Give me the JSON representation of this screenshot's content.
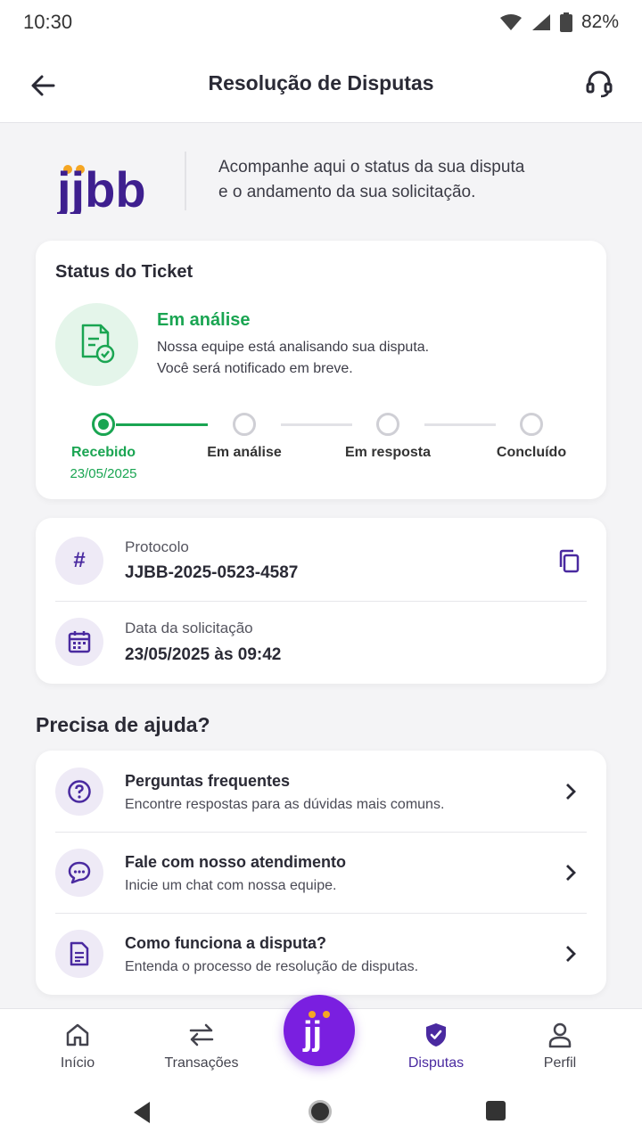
{
  "status_bar": {
    "time": "10:30",
    "battery": "82%"
  },
  "app_bar": {
    "title": "Resolução de Disputas"
  },
  "intro": {
    "logo_text": "jjbb",
    "line1": "Acompanhe aqui o status da sua disputa",
    "line2": "e o andamento da sua solicitação."
  },
  "ticket": {
    "heading": "Status do Ticket",
    "status_title": "Em análise",
    "status_line1": "Nossa equipe está analisando sua disputa.",
    "status_line2": "Você será notificado em breve.",
    "steps": [
      {
        "label": "Recebido",
        "date": "23/05/2025",
        "active": true
      },
      {
        "label": "Em análise",
        "active": false
      },
      {
        "label": "Em resposta",
        "active": false
      },
      {
        "label": "Concluído",
        "active": false
      }
    ]
  },
  "info": {
    "protocol_label": "Protocolo",
    "protocol_value": "JJBB-2025-0523-4587",
    "date_label": "Data da solicitação",
    "date_value": "23/05/2025 às 09:42"
  },
  "help": {
    "title": "Precisa de ajuda?",
    "items": [
      {
        "title": "Perguntas frequentes",
        "subtitle": "Encontre respostas para as dúvidas mais comuns.",
        "icon": "question-icon"
      },
      {
        "title": "Fale com nosso atendimento",
        "subtitle": "Inicie um chat com nossa equipe.",
        "icon": "chat-icon"
      },
      {
        "title": "Como funciona a disputa?",
        "subtitle": "Entenda o processo de resolução de disputas.",
        "icon": "document-icon"
      }
    ]
  },
  "bottom_nav": {
    "items": [
      {
        "label": "Início",
        "icon": "home-icon"
      },
      {
        "label": "Transações",
        "icon": "transfer-icon"
      },
      {
        "label": "Disputas",
        "icon": "shield-check-icon",
        "active": true
      },
      {
        "label": "Perfil",
        "icon": "profile-icon"
      }
    ],
    "fab_text": "jj"
  },
  "colors": {
    "accent": "#4a2aa0",
    "fab": "#7a1fe0",
    "success": "#1aa552",
    "logo_dots": "#f5a623"
  }
}
